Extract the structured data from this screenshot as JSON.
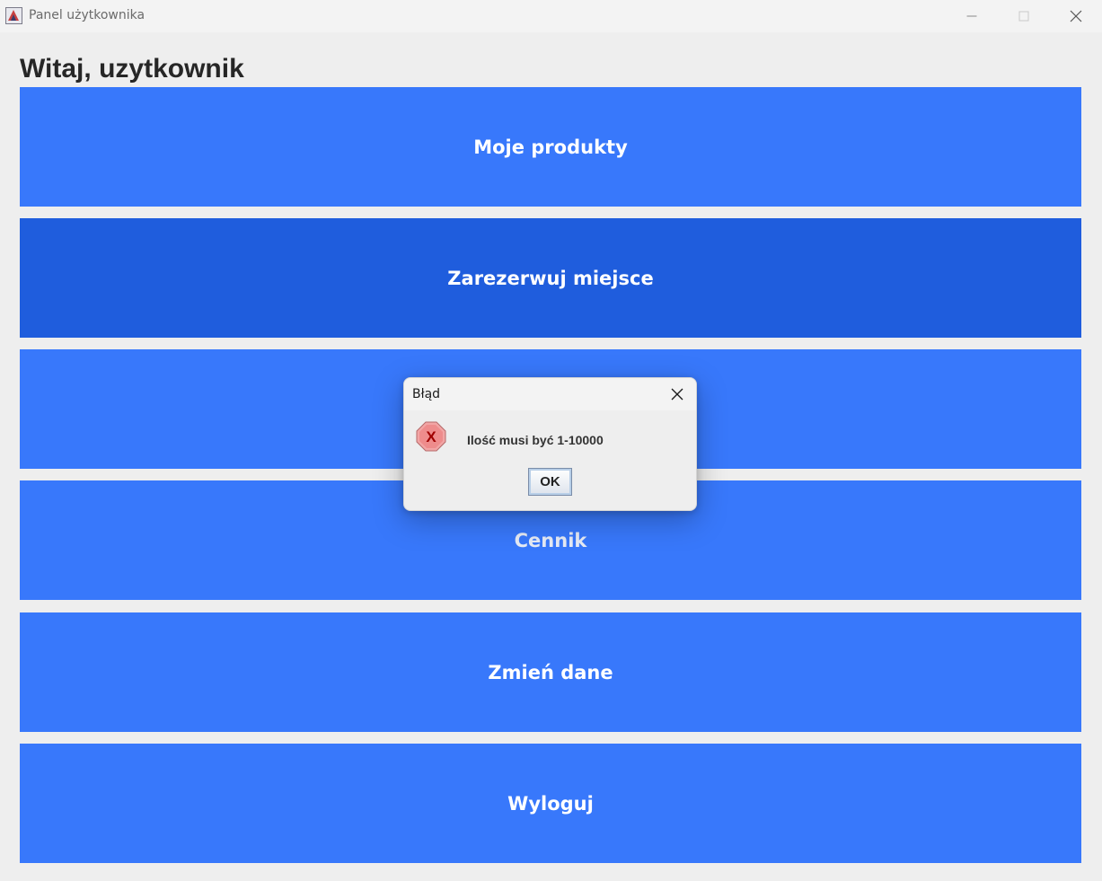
{
  "window": {
    "title": "Panel użytkownika"
  },
  "main": {
    "greeting": "Witaj, uzytkownik",
    "buttons": [
      {
        "label": "Moje produkty"
      },
      {
        "label": "Zarezerwuj miejsce"
      },
      {
        "label": ""
      },
      {
        "label": "Cennik"
      },
      {
        "label": "Zmień dane"
      },
      {
        "label": "Wyloguj"
      }
    ]
  },
  "dialog": {
    "title": "Błąd",
    "message": "Ilość musi być 1-10000",
    "ok_label": "OK",
    "icon": "error-icon"
  },
  "colors": {
    "button": "#3878fb",
    "button_hover": "#1f5ddd",
    "background": "#eeeeee"
  }
}
